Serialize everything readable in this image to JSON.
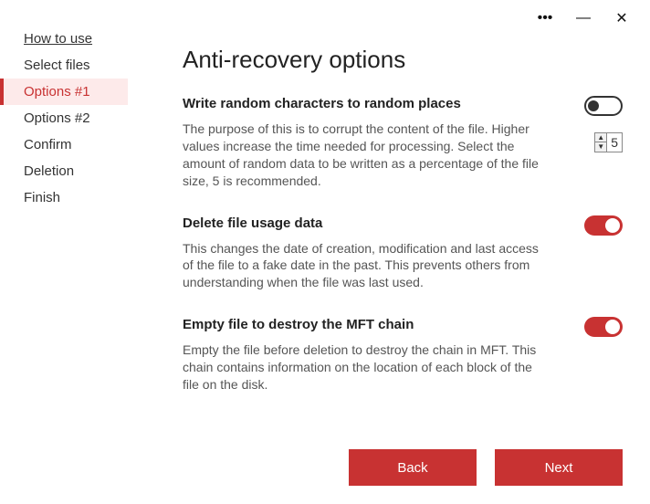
{
  "titlebar": {
    "more_icon": "•••",
    "minimize_icon": "—",
    "close_icon": "✕"
  },
  "sidebar": {
    "items": [
      {
        "label": "How to use",
        "link": true,
        "active": false
      },
      {
        "label": "Select files",
        "link": false,
        "active": false
      },
      {
        "label": "Options #1",
        "link": false,
        "active": true
      },
      {
        "label": "Options #2",
        "link": false,
        "active": false
      },
      {
        "label": "Confirm",
        "link": false,
        "active": false
      },
      {
        "label": "Deletion",
        "link": false,
        "active": false
      },
      {
        "label": "Finish",
        "link": false,
        "active": false
      }
    ]
  },
  "main": {
    "title": "Anti-recovery options",
    "options": [
      {
        "title": "Write random characters to random places",
        "desc": "The purpose of this is to corrupt the content of the file. Higher values increase the time needed for processing. Select the amount of random data to be written as a percentage of the file size, 5 is recommended.",
        "toggle": "off",
        "spinner_value": "5"
      },
      {
        "title": "Delete file usage data",
        "desc": "This changes the date of creation, modification and last access of the file to a fake date in the past. This prevents others from understanding when the file was last used.",
        "toggle": "on"
      },
      {
        "title": "Empty file to destroy the MFT chain",
        "desc": "Empty the file before deletion to destroy the chain in MFT. This chain contains information on the location of each block of the file on the disk.",
        "toggle": "on"
      }
    ]
  },
  "footer": {
    "back_label": "Back",
    "next_label": "Next"
  },
  "colors": {
    "accent": "#c83232"
  }
}
